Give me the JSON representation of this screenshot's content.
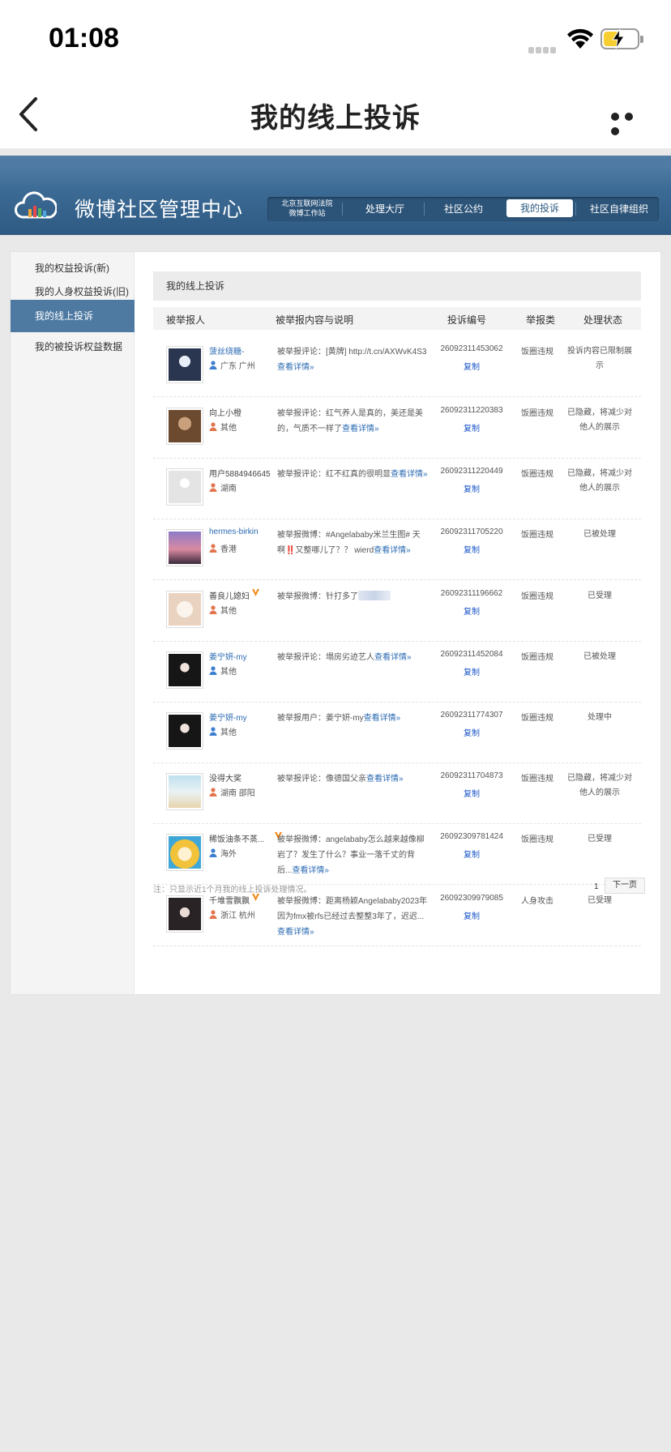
{
  "status_bar": {
    "time": "01:08"
  },
  "nav": {
    "title": "我的线上投诉"
  },
  "header": {
    "title": "微博社区管理中心",
    "court_line1": "北京互联网法院",
    "court_line2": "微博工作站",
    "tabs": [
      {
        "label": "处理大厅",
        "active": false
      },
      {
        "label": "社区公约",
        "active": false
      },
      {
        "label": "我的投诉",
        "active": true
      },
      {
        "label": "社区自律组织",
        "active": false
      }
    ]
  },
  "sidebar": {
    "items": [
      {
        "label": "我的权益投诉(新)",
        "active": false
      },
      {
        "label": "我的人身权益投诉(旧)",
        "active": false
      },
      {
        "label": "我的线上投诉",
        "active": true
      },
      {
        "label": "我的被投诉权益数据",
        "active": false
      }
    ]
  },
  "main": {
    "title": "我的线上投诉",
    "columns": [
      "被举报人",
      "被举报内容与说明",
      "投诉编号",
      "举报类",
      "处理状态"
    ],
    "rows": [
      {
        "name": "菠丝绕糖-",
        "name_link": true,
        "location": "广东 广州",
        "gender": "male",
        "desc": "被举报评论：[黄牌] http://t.cn/AXWvK4S3",
        "more": "查看详情»",
        "id": "26092311453062",
        "copy": "复制",
        "category": "饭圈违规",
        "status": "投诉内容已限制展示",
        "avatar": "cat"
      },
      {
        "name": "向上小橙",
        "name_link": false,
        "location": "其他",
        "gender": "female",
        "desc": "被举报评论：红气养人是真的，美还是美的，气质不一样了",
        "more": "查看详情»",
        "id": "26092311220383",
        "copy": "复制",
        "category": "饭圈违规",
        "status": "已隐藏，将减少对他人的展示",
        "avatar": "man"
      },
      {
        "name": "用户5884946645",
        "name_link": false,
        "location": "湖南",
        "gender": "female",
        "desc": "被举报评论：红不红真的很明显",
        "more": "查看详情»",
        "id": "26092311220449",
        "copy": "复制",
        "category": "饭圈违规",
        "status": "已隐藏，将减少对他人的展示",
        "avatar": "default"
      },
      {
        "name": "hermes-birkin",
        "name_link": true,
        "location": "香港",
        "gender": "female",
        "desc": "被举报微博：#Angelababy米兰生图# 天啊‼️又整哪儿了？？ wierd",
        "more": "查看详情»",
        "id": "26092311705220",
        "copy": "复制",
        "category": "饭圈违规",
        "status": "已被处理",
        "avatar": "sunset"
      },
      {
        "name": "善良儿媳妇",
        "name_link": false,
        "location": "其他",
        "gender": "female",
        "vip": true,
        "desc": "被举报微博：针打多了",
        "more": "",
        "id": "26092311196662",
        "copy": "复制",
        "category": "饭圈违规",
        "status": "已受理",
        "avatar": "dog"
      },
      {
        "name": "姜宁妍-my",
        "name_link": true,
        "location": "其他",
        "gender": "male",
        "desc": "被举报评论：塌房劣迹艺人",
        "more": "查看详情»",
        "id": "26092311452084",
        "copy": "复制",
        "category": "饭圈违规",
        "status": "已被处理",
        "avatar": "woman"
      },
      {
        "name": "姜宁妍-my",
        "name_link": true,
        "location": "其他",
        "gender": "male",
        "desc": "被举报用户：姜宁妍-my",
        "more": "查看详情»",
        "id": "26092311774307",
        "copy": "复制",
        "category": "饭圈违规",
        "status": "处理中",
        "avatar": "woman"
      },
      {
        "name": "没得大奖",
        "name_link": false,
        "location": "湖南 邵阳",
        "gender": "female",
        "desc": "被举报评论：像德国父亲",
        "more": "查看详情»",
        "id": "26092311704873",
        "copy": "复制",
        "category": "饭圈违规",
        "status": "已隐藏，将减少对他人的展示",
        "avatar": "beach"
      },
      {
        "name": "稀饭油条不蒸...",
        "name_link": false,
        "location": "海外",
        "gender": "male",
        "vip": true,
        "desc": "被举报微博：angelababy怎么越来越像柳岩了？发生了什么？事业一落千丈的背后...",
        "more": "查看详情»",
        "id": "26092309781424",
        "copy": "复制",
        "category": "饭圈违规",
        "status": "已受理",
        "avatar": "anime"
      },
      {
        "name": "千堆雪飘飘",
        "name_link": false,
        "location": "浙江 杭州",
        "gender": "female",
        "vip": true,
        "desc": "被举报微博：距离杨颖Angelababy2023年因为fmx被rfs已经过去整整3年了，迟迟...",
        "more": "查看详情»",
        "id": "26092309979085",
        "copy": "复制",
        "category": "人身攻击",
        "status": "已受理",
        "avatar": "girl"
      }
    ],
    "note": "注：只显示近1个月我的线上投诉处理情况。",
    "page": "1",
    "next": "下一页"
  }
}
